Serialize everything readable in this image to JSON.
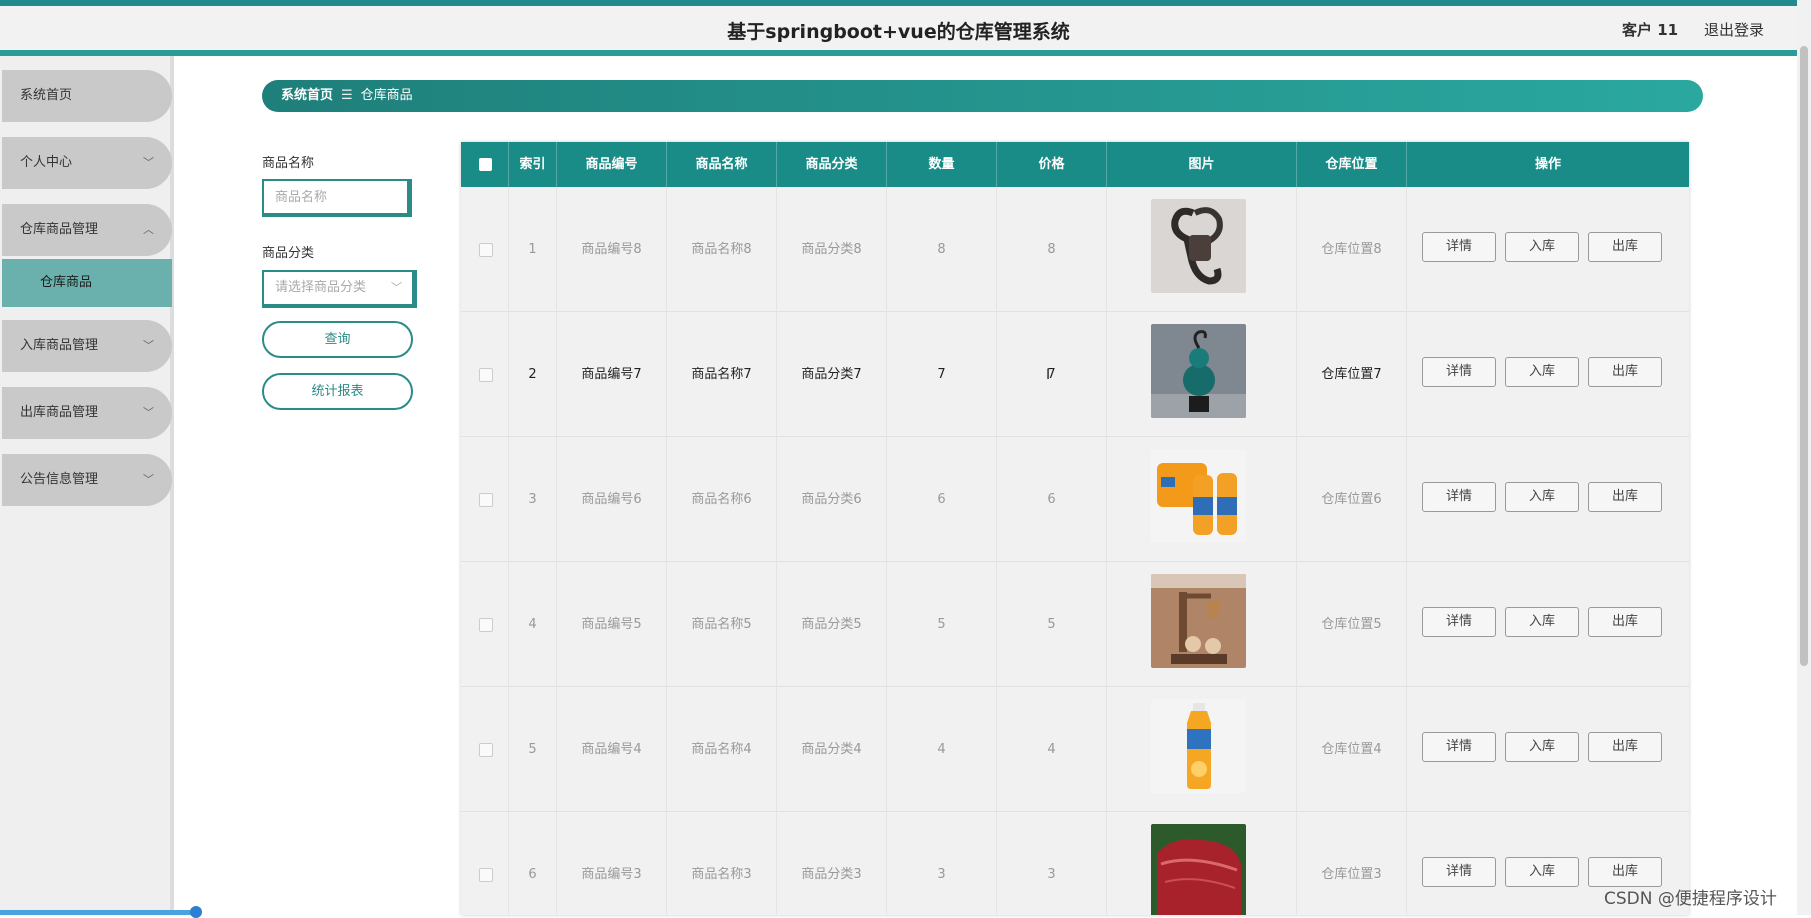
{
  "header": {
    "title": "基于springboot+vue的仓库管理系统",
    "user": "客户 11",
    "logout": "退出登录"
  },
  "sidebar": {
    "items": [
      {
        "label": "系统首页",
        "chevron": ""
      },
      {
        "label": "个人中心",
        "chevron": "﹀"
      },
      {
        "label": "仓库商品管理",
        "chevron": "︿"
      },
      {
        "label": "入库商品管理",
        "chevron": "﹀"
      },
      {
        "label": "出库商品管理",
        "chevron": "﹀"
      },
      {
        "label": "公告信息管理",
        "chevron": "﹀"
      }
    ],
    "subitem": "仓库商品"
  },
  "breadcrumb": {
    "home": "系统首页",
    "sep": "☰",
    "current": "仓库商品"
  },
  "search": {
    "name_label": "商品名称",
    "name_placeholder": "商品名称",
    "category_label": "商品分类",
    "category_placeholder": "请选择商品分类",
    "query_button": "查询",
    "report_button": "统计报表"
  },
  "table": {
    "headers": [
      "索引",
      "商品编号",
      "商品名称",
      "商品分类",
      "数量",
      "价格",
      "图片",
      "仓库位置",
      "操作"
    ],
    "rows": [
      {
        "index": "1",
        "code": "商品编号8",
        "name": "商品名称8",
        "category": "商品分类8",
        "qty": "8",
        "price": "8",
        "location": "仓库位置8",
        "image": "rope-bracelet-image"
      },
      {
        "index": "2",
        "code": "商品编号7",
        "name": "商品名称7",
        "category": "商品分类7",
        "qty": "7",
        "price": "7",
        "location": "仓库位置7",
        "image": "gourd-ornament-image"
      },
      {
        "index": "3",
        "code": "商品编号6",
        "name": "商品名称6",
        "category": "商品分类6",
        "qty": "6",
        "price": "6",
        "location": "仓库位置6",
        "image": "orange-juice-pack-image"
      },
      {
        "index": "4",
        "code": "商品编号5",
        "name": "商品名称5",
        "category": "商品分类5",
        "qty": "5",
        "price": "5",
        "location": "仓库位置5",
        "image": "wooden-ornament-image"
      },
      {
        "index": "5",
        "code": "商品编号4",
        "name": "商品名称4",
        "category": "商品分类4",
        "qty": "4",
        "price": "4",
        "location": "仓库位置4",
        "image": "juice-bottle-image"
      },
      {
        "index": "6",
        "code": "商品编号3",
        "name": "商品名称3",
        "category": "商品分类3",
        "qty": "3",
        "price": "3",
        "location": "仓库位置3",
        "image": "beef-image"
      }
    ],
    "actions": {
      "detail": "详情",
      "stock_in": "入库",
      "stock_out": "出库"
    }
  },
  "watermark": "CSDN @便捷程序设计",
  "colors": {
    "primary": "#1a8c88",
    "accent": "#2b8b86",
    "menu": "#c9c9c9",
    "submenu": "#6ab1ad"
  }
}
